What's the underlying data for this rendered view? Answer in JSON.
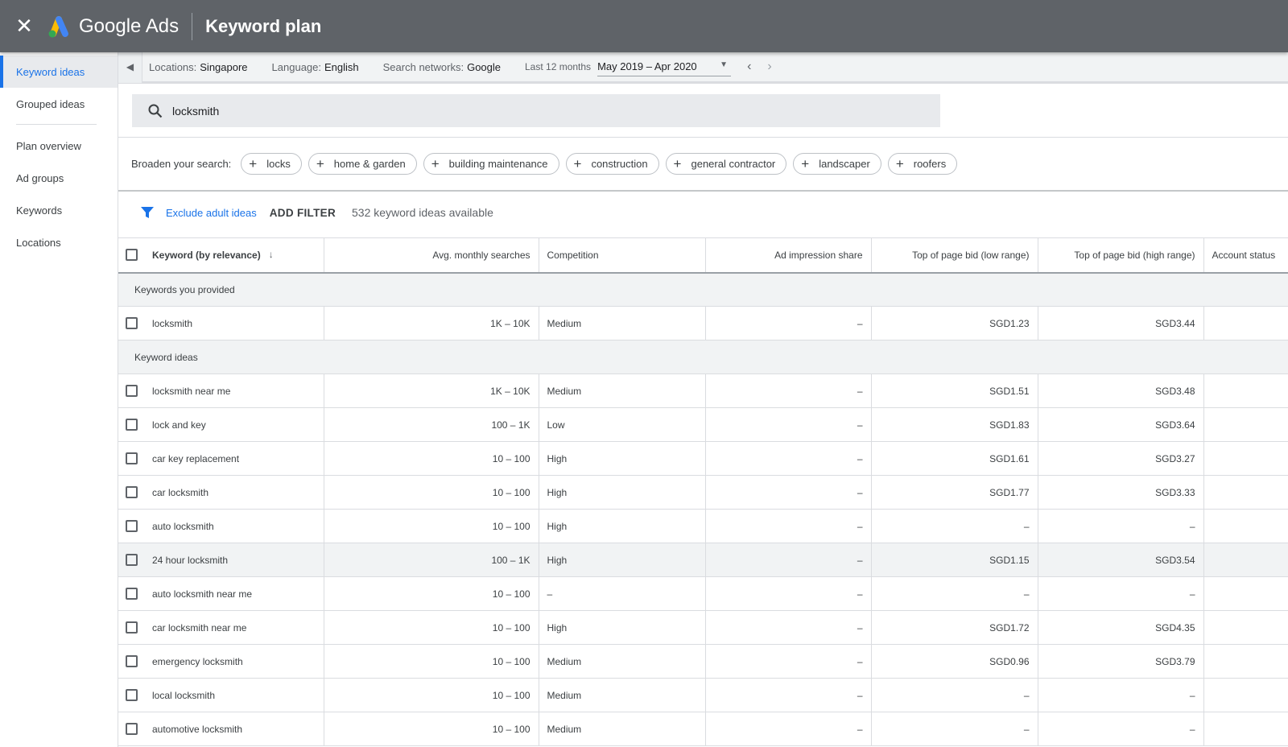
{
  "header": {
    "close_icon": "close-icon",
    "brand": "Google Ads",
    "title": "Keyword plan"
  },
  "sidebar": {
    "items": [
      {
        "label": "Keyword ideas",
        "active": true
      },
      {
        "label": "Grouped ideas"
      },
      {
        "label": "Plan overview"
      },
      {
        "label": "Ad groups"
      },
      {
        "label": "Keywords"
      },
      {
        "label": "Locations"
      }
    ]
  },
  "filterbar": {
    "locations_label": "Locations:",
    "locations": "Singapore",
    "language_label": "Language:",
    "language": "English",
    "networks_label": "Search networks:",
    "networks": "Google",
    "period_label": "Last 12 months",
    "period": "May 2019 – Apr 2020"
  },
  "search": {
    "value": "locksmith"
  },
  "broaden": {
    "label": "Broaden your search:",
    "chips": [
      "locks",
      "home & garden",
      "building maintenance",
      "construction",
      "general contractor",
      "landscaper",
      "roofers"
    ]
  },
  "filters": {
    "exclude": "Exclude adult ideas",
    "add": "ADD FILTER",
    "count": "532 keyword ideas available"
  },
  "table": {
    "headers": [
      "Keyword (by relevance)",
      "Avg. monthly searches",
      "Competition",
      "Ad impression share",
      "Top of page bid (low range)",
      "Top of page bid (high range)",
      "Account status"
    ],
    "group_provided": "Keywords you provided",
    "provided": [
      [
        "locksmith",
        "1K – 10K",
        "Medium",
        "–",
        "SGD1.23",
        "SGD3.44",
        ""
      ]
    ],
    "group_ideas": "Keyword ideas",
    "ideas": [
      [
        "locksmith near me",
        "1K – 10K",
        "Medium",
        "–",
        "SGD1.51",
        "SGD3.48",
        ""
      ],
      [
        "lock and key",
        "100 – 1K",
        "Low",
        "–",
        "SGD1.83",
        "SGD3.64",
        ""
      ],
      [
        "car key replacement",
        "10 – 100",
        "High",
        "–",
        "SGD1.61",
        "SGD3.27",
        ""
      ],
      [
        "car locksmith",
        "10 – 100",
        "High",
        "–",
        "SGD1.77",
        "SGD3.33",
        ""
      ],
      [
        "auto locksmith",
        "10 – 100",
        "High",
        "–",
        "–",
        "–",
        ""
      ],
      [
        "24 hour locksmith",
        "100 – 1K",
        "High",
        "–",
        "SGD1.15",
        "SGD3.54",
        ""
      ],
      [
        "auto locksmith near me",
        "10 – 100",
        "–",
        "–",
        "–",
        "–",
        ""
      ],
      [
        "car locksmith near me",
        "10 – 100",
        "High",
        "–",
        "SGD1.72",
        "SGD4.35",
        ""
      ],
      [
        "emergency locksmith",
        "10 – 100",
        "Medium",
        "–",
        "SGD0.96",
        "SGD3.79",
        ""
      ],
      [
        "local locksmith",
        "10 – 100",
        "Medium",
        "–",
        "–",
        "–",
        ""
      ],
      [
        "automotive locksmith",
        "10 – 100",
        "Medium",
        "–",
        "–",
        "–",
        ""
      ]
    ]
  },
  "colors": {
    "header": "#5f6368",
    "accent": "#1a73e8"
  }
}
